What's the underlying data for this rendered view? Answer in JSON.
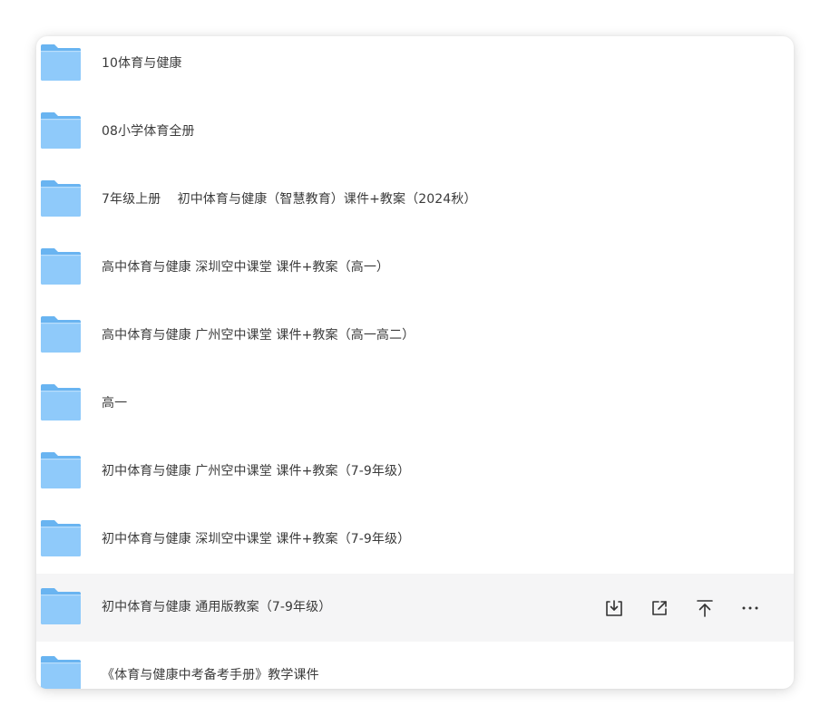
{
  "files": {
    "items": [
      {
        "name": "10体育与健康",
        "icon": "folder-icon"
      },
      {
        "name": "08小学体育全册",
        "icon": "folder-icon"
      },
      {
        "name": "7年级上册    初中体育与健康（智慧教育）课件+教案（2024秋）",
        "icon": "folder-icon"
      },
      {
        "name": "高中体育与健康 深圳空中课堂 课件+教案（高一）",
        "icon": "folder-icon"
      },
      {
        "name": "高中体育与健康 广州空中课堂 课件+教案（高一高二）",
        "icon": "folder-icon"
      },
      {
        "name": "高一",
        "icon": "folder-icon"
      },
      {
        "name": "初中体育与健康 广州空中课堂 课件+教案（7-9年级）",
        "icon": "folder-icon"
      },
      {
        "name": "初中体育与健康 深圳空中课堂 课件+教案（7-9年级）",
        "icon": "folder-icon"
      },
      {
        "name": "初中体育与健康 通用版教案（7-9年级）",
        "icon": "folder-icon",
        "hovered": true
      },
      {
        "name": "《体育与健康中考备考手册》教学课件",
        "icon": "folder-icon"
      }
    ],
    "hover_actions": [
      "download-icon",
      "share-icon",
      "move-to-top-icon",
      "more-icon"
    ]
  },
  "colors": {
    "folder_back": "#69b4f1",
    "folder_front": "#8fcafa",
    "hover_bg": "#f5f5f6",
    "text": "#3b3b3b",
    "icon": "#333333"
  }
}
